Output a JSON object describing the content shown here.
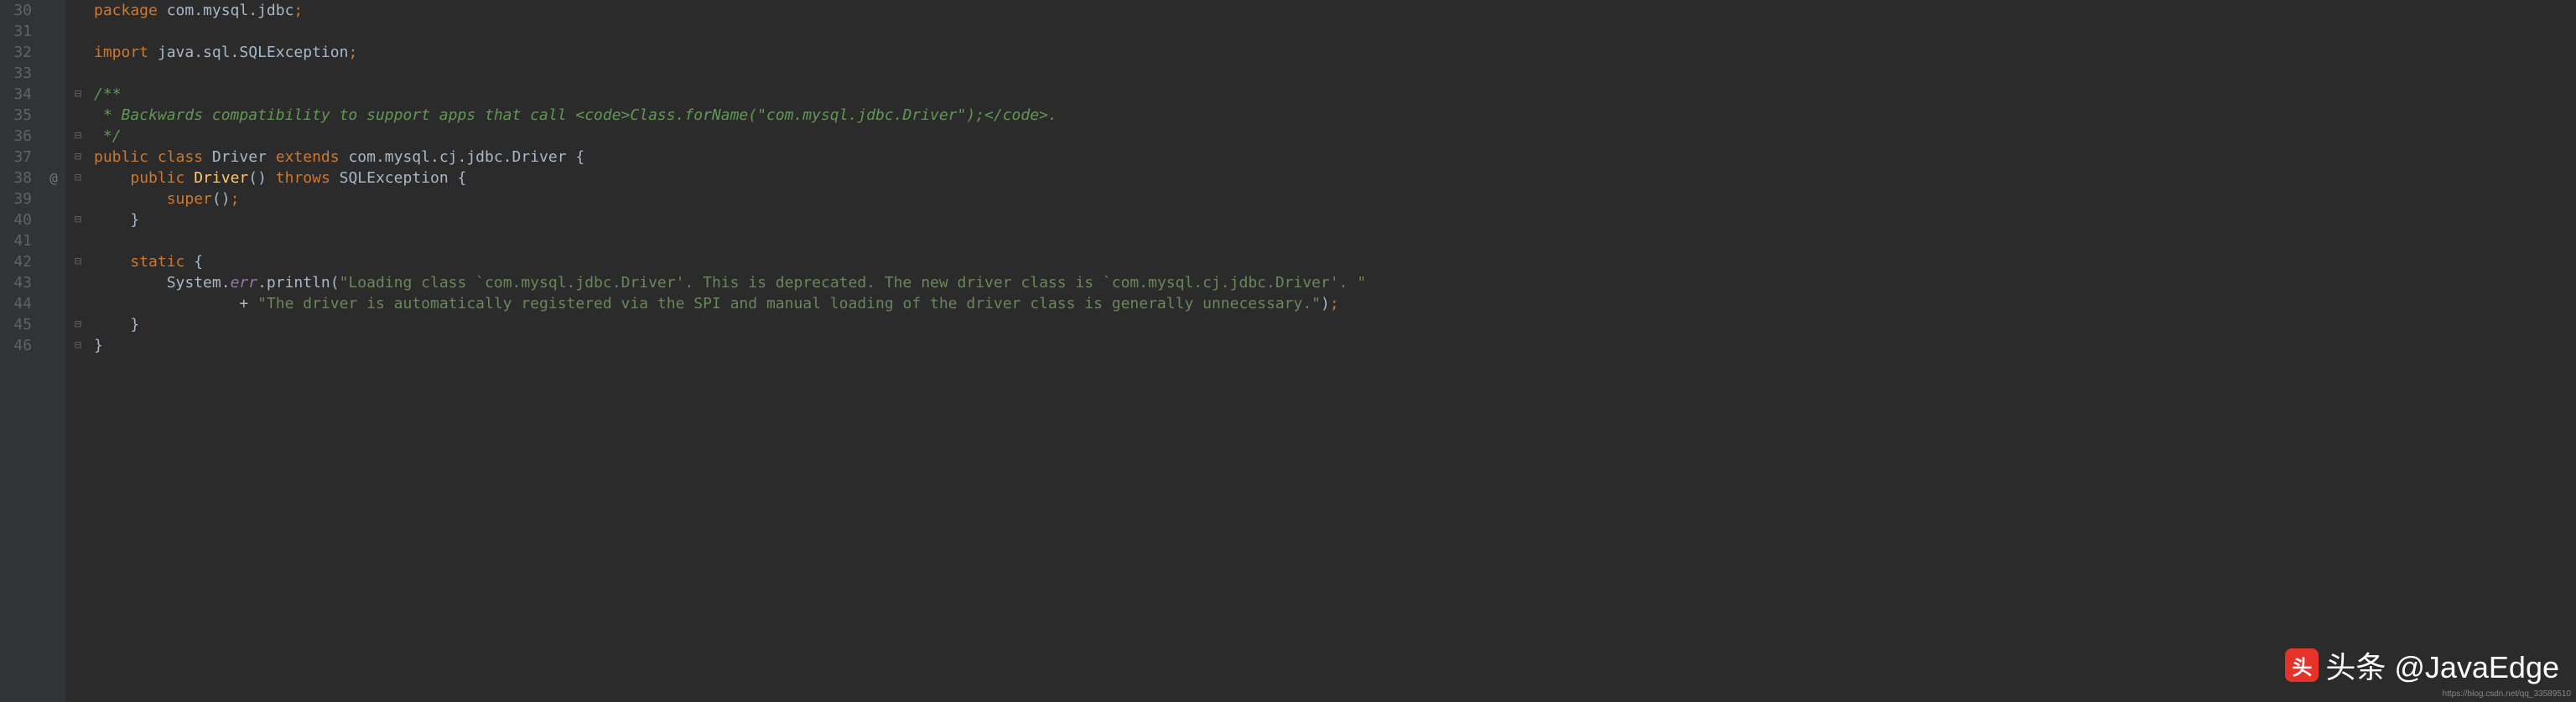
{
  "lines": [
    {
      "num": "30",
      "fold": "",
      "ann": "",
      "tokens": [
        {
          "cls": "kw",
          "t": "package "
        },
        {
          "cls": "",
          "t": "com.mysql.jdbc"
        },
        {
          "cls": "semi",
          "t": ";"
        }
      ]
    },
    {
      "num": "31",
      "fold": "",
      "ann": "",
      "tokens": []
    },
    {
      "num": "32",
      "fold": "",
      "ann": "",
      "tokens": [
        {
          "cls": "kw",
          "t": "import "
        },
        {
          "cls": "",
          "t": "java.sql.SQLException"
        },
        {
          "cls": "semi",
          "t": ";"
        }
      ]
    },
    {
      "num": "33",
      "fold": "",
      "ann": "",
      "tokens": []
    },
    {
      "num": "34",
      "fold": "⊟",
      "ann": "",
      "tokens": [
        {
          "cls": "doc-comment",
          "t": "/**"
        }
      ]
    },
    {
      "num": "35",
      "fold": "",
      "ann": "",
      "tokens": [
        {
          "cls": "doc-comment",
          "t": " * Backwards compatibility to support apps that call "
        },
        {
          "cls": "doc-tag",
          "t": "<code>"
        },
        {
          "cls": "doc-comment",
          "t": "Class.forName(\"com.mysql.jdbc.Driver\");"
        },
        {
          "cls": "doc-tag",
          "t": "</code>"
        },
        {
          "cls": "doc-comment",
          "t": "."
        }
      ]
    },
    {
      "num": "36",
      "fold": "⊟",
      "ann": "",
      "tokens": [
        {
          "cls": "doc-comment",
          "t": " */"
        }
      ]
    },
    {
      "num": "37",
      "fold": "⊟",
      "ann": "",
      "tokens": [
        {
          "cls": "kw",
          "t": "public class "
        },
        {
          "cls": "class-name",
          "t": "Driver "
        },
        {
          "cls": "kw",
          "t": "extends "
        },
        {
          "cls": "",
          "t": "com.mysql.cj.jdbc.Driver "
        },
        {
          "cls": "brace",
          "t": "{"
        }
      ]
    },
    {
      "num": "38",
      "fold": "⊟",
      "ann": "@",
      "tokens": [
        {
          "cls": "",
          "t": "    "
        },
        {
          "cls": "kw",
          "t": "public "
        },
        {
          "cls": "method",
          "t": "Driver"
        },
        {
          "cls": "",
          "t": "() "
        },
        {
          "cls": "kw",
          "t": "throws "
        },
        {
          "cls": "",
          "t": "SQLException "
        },
        {
          "cls": "brace",
          "t": "{"
        }
      ]
    },
    {
      "num": "39",
      "fold": "",
      "ann": "",
      "tokens": [
        {
          "cls": "",
          "t": "        "
        },
        {
          "cls": "kw",
          "t": "super"
        },
        {
          "cls": "",
          "t": "()"
        },
        {
          "cls": "semi",
          "t": ";"
        }
      ]
    },
    {
      "num": "40",
      "fold": "⊟",
      "ann": "",
      "tokens": [
        {
          "cls": "",
          "t": "    "
        },
        {
          "cls": "brace",
          "t": "}"
        }
      ]
    },
    {
      "num": "41",
      "fold": "",
      "ann": "",
      "tokens": []
    },
    {
      "num": "42",
      "fold": "⊟",
      "ann": "",
      "tokens": [
        {
          "cls": "",
          "t": "    "
        },
        {
          "cls": "kw",
          "t": "static "
        },
        {
          "cls": "brace",
          "t": "{"
        }
      ]
    },
    {
      "num": "43",
      "fold": "",
      "ann": "",
      "tokens": [
        {
          "cls": "",
          "t": "        System."
        },
        {
          "cls": "static-field",
          "t": "err"
        },
        {
          "cls": "",
          "t": ".println("
        },
        {
          "cls": "str",
          "t": "\"Loading class `com.mysql.jdbc.Driver'. This is deprecated. The new driver class is `com.mysql.cj.jdbc.Driver'. \""
        }
      ]
    },
    {
      "num": "44",
      "fold": "",
      "ann": "",
      "tokens": [
        {
          "cls": "",
          "t": "                + "
        },
        {
          "cls": "str",
          "t": "\"The driver is automatically registered via the SPI and manual loading of the driver class is generally unnecessary.\""
        },
        {
          "cls": "",
          "t": ")"
        },
        {
          "cls": "semi",
          "t": ";"
        }
      ]
    },
    {
      "num": "45",
      "fold": "⊟",
      "ann": "",
      "tokens": [
        {
          "cls": "",
          "t": "    "
        },
        {
          "cls": "brace",
          "t": "}"
        }
      ]
    },
    {
      "num": "46",
      "fold": "⊟",
      "ann": "",
      "tokens": [
        {
          "cls": "brace",
          "t": "}"
        }
      ]
    }
  ],
  "watermark": {
    "text": "头条 @JavaEdge",
    "icon": "头"
  },
  "url": "https://blog.csdn.net/qq_33589510"
}
